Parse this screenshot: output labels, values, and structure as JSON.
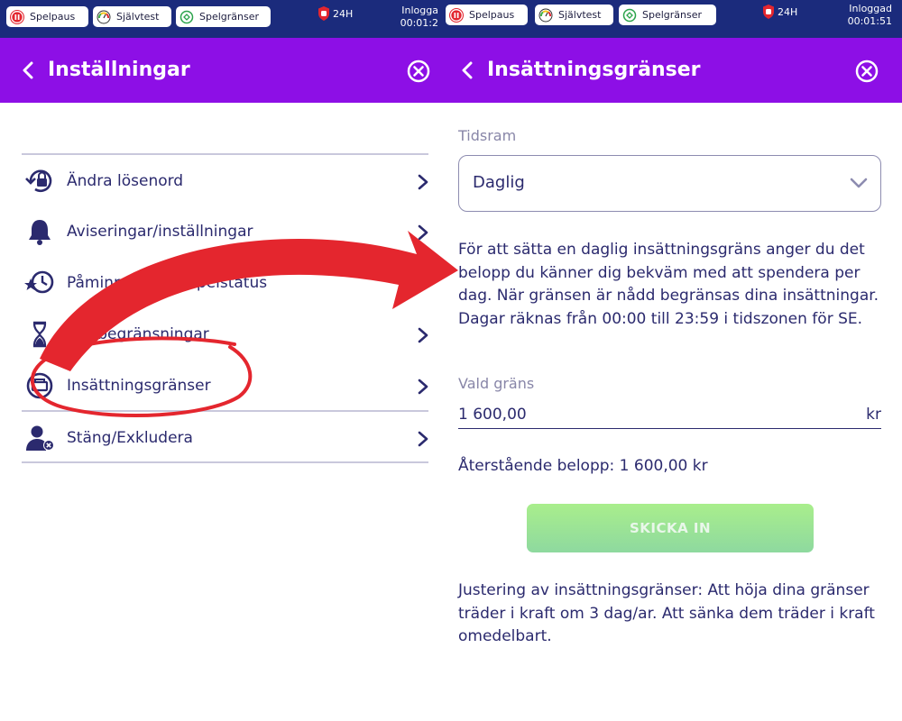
{
  "topbar": {
    "buttons": [
      {
        "label": "Spelpaus",
        "icon": "pause-icon"
      },
      {
        "label": "Självtest",
        "icon": "gauge-icon"
      },
      {
        "label": "Spelgränser",
        "icon": "limit-icon"
      }
    ],
    "reality_check": "24H",
    "left_login": {
      "label": "Inlogga",
      "time": "00:01:2"
    },
    "right_login": {
      "label": "Inloggad",
      "time": "00:01:51"
    }
  },
  "left": {
    "title": "Inställningar",
    "items": [
      {
        "label": "Ändra lösenord",
        "icon": "password-reset-icon"
      },
      {
        "label": "Aviseringar/inställningar",
        "icon": "bell-icon"
      },
      {
        "label": "Påminnelse om spelstatus",
        "icon": "clock-reminder-icon"
      },
      {
        "label": "Tidsbegränsningar",
        "icon": "hourglass-icon"
      },
      {
        "label": "Insättningsgränser",
        "icon": "deposit-icon"
      },
      {
        "label": "Stäng/Exkludera",
        "icon": "user-exclude-icon"
      }
    ]
  },
  "right": {
    "title": "Insättningsgränser",
    "timeframe_label": "Tidsram",
    "timeframe_value": "Daglig",
    "description": "För att sätta en daglig insättningsgräns anger du det belopp du känner dig bekväm med att spendera per dag. När gränsen är nådd begränsas dina insättningar. Dagar räknas från 00:00 till 23:59 i tidszonen för SE.",
    "limit_label": "Vald gräns",
    "limit_value": "1 600,00",
    "limit_unit": "kr",
    "remaining": "Återstående belopp: 1 600,00 kr",
    "submit_label": "SKICKA IN",
    "adjustment_note": "Justering av insättningsgränser: Att höja dina gränser träder i kraft om 3 dag/ar. Att sänka dem träder i kraft omedelbart."
  },
  "colors": {
    "topbar": "#1b2b7c",
    "header": "#8d0fe6",
    "text": "#2b2a6e",
    "annotation": "#e4262e",
    "submit": "#a9ee8c"
  }
}
